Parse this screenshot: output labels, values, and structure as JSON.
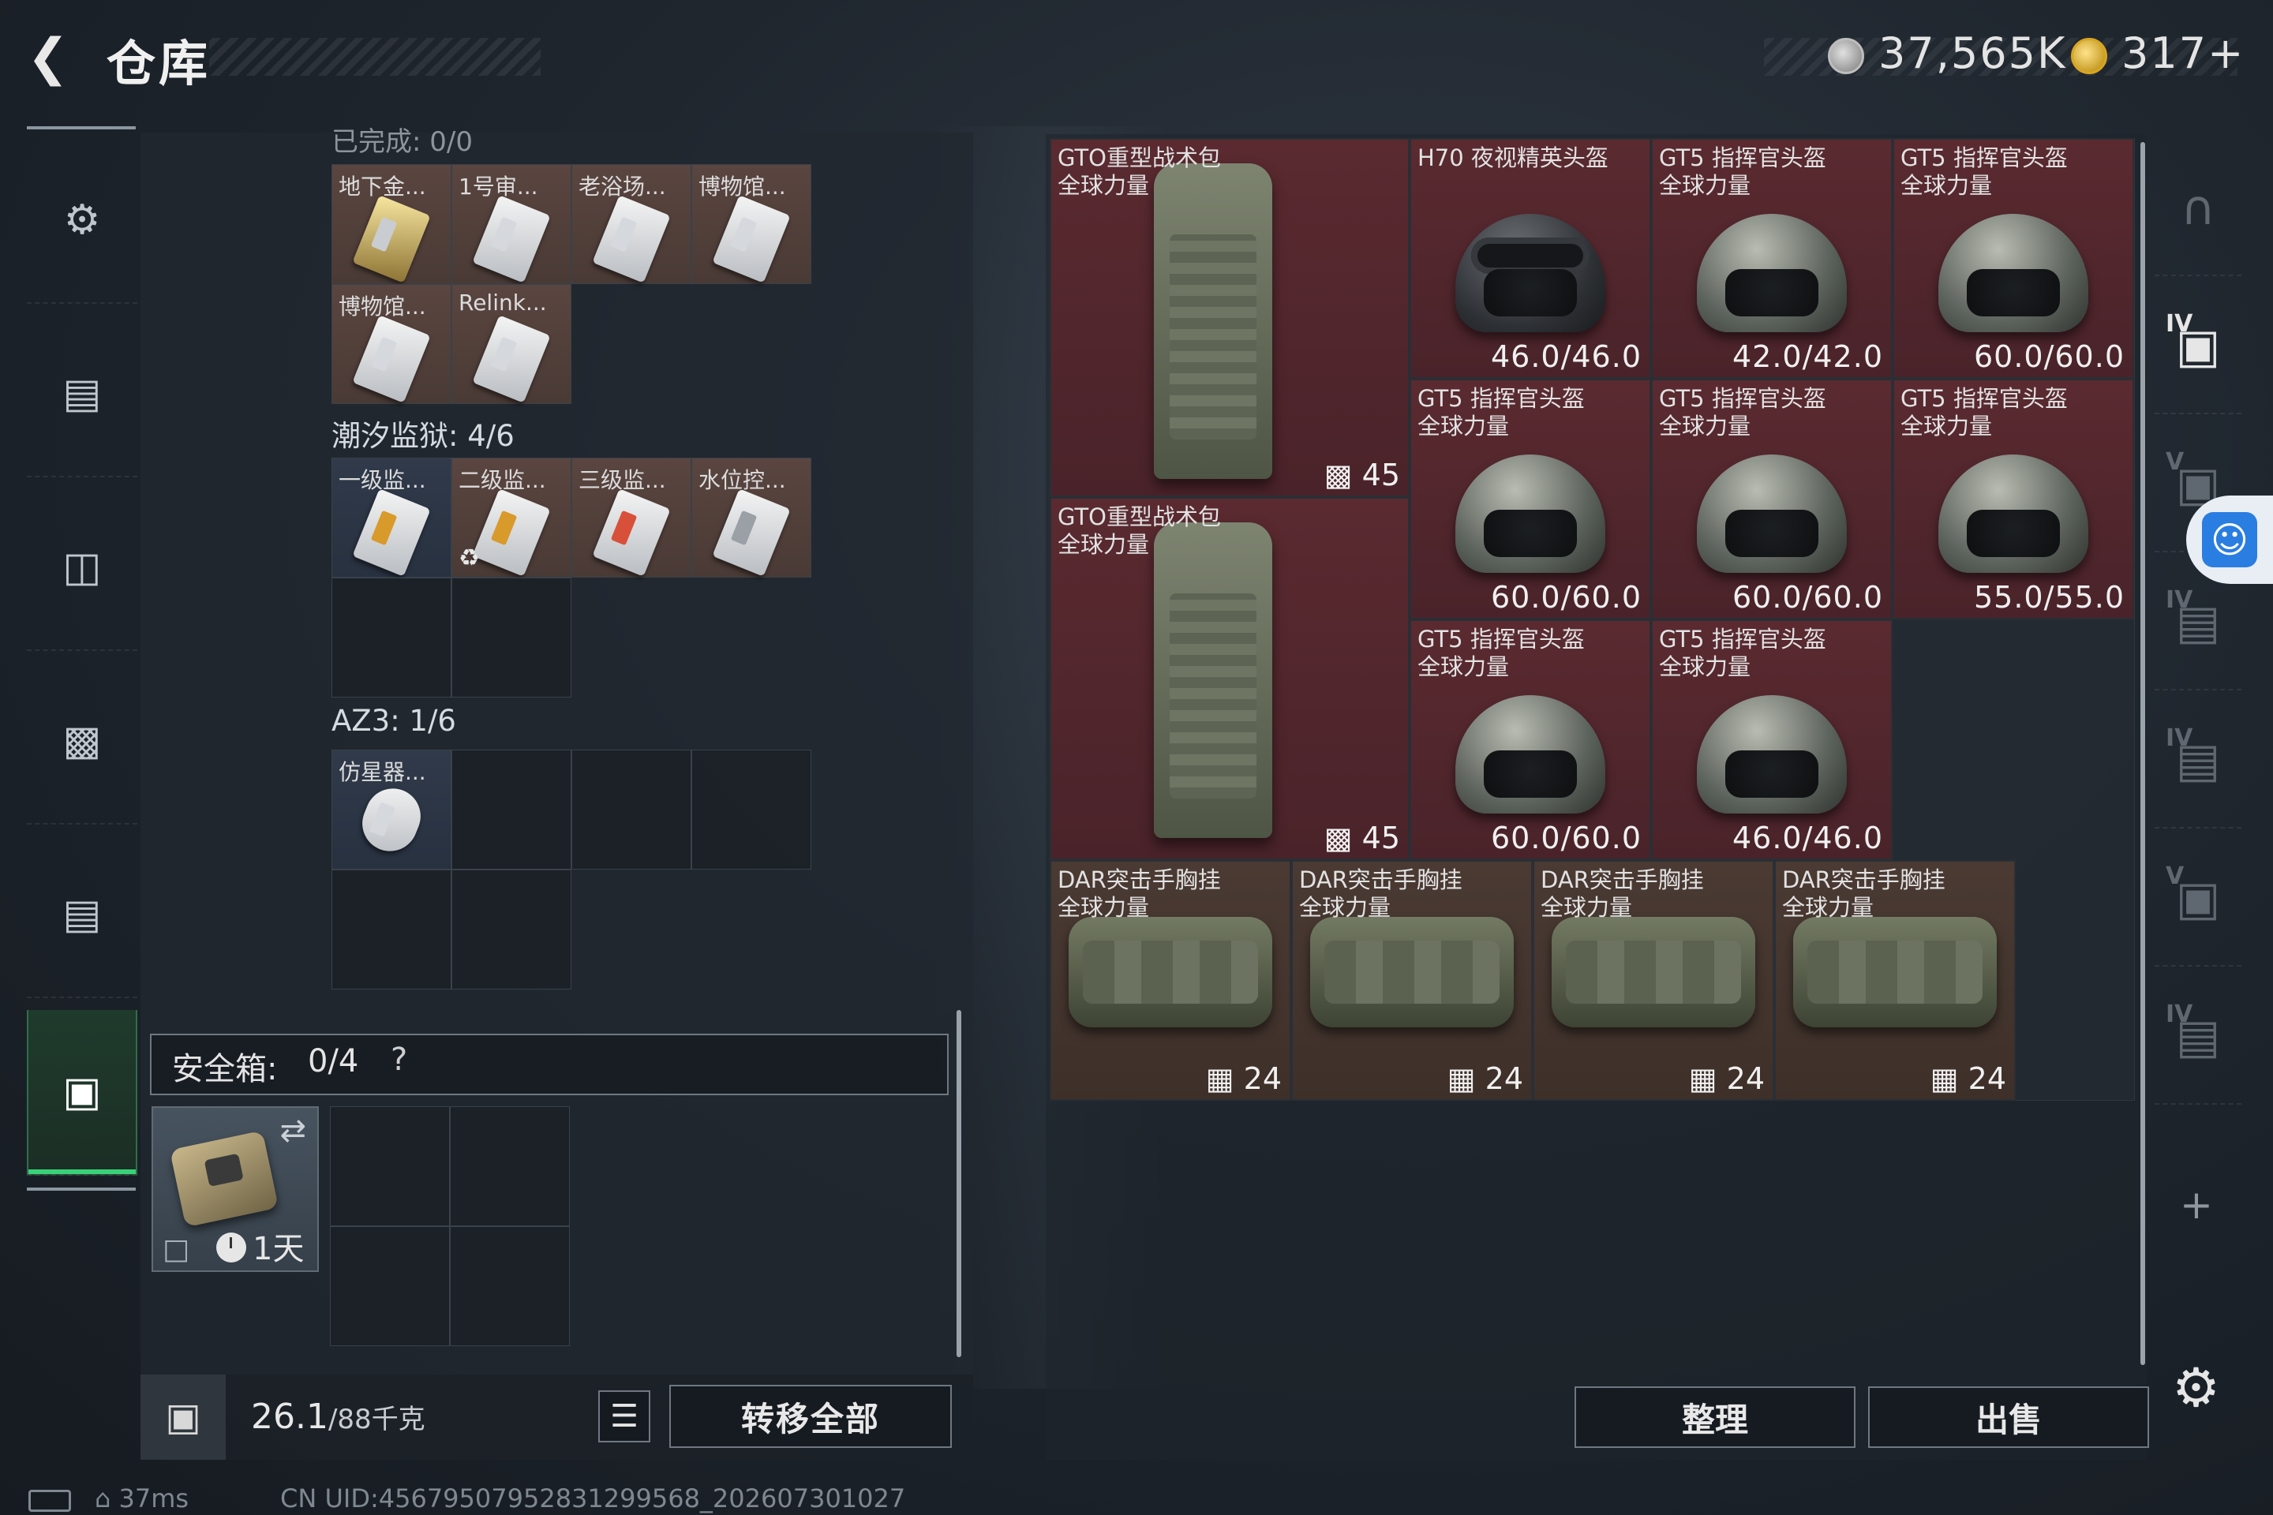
{
  "header": {
    "back_icon": "back-arrow-icon",
    "title": "仓库"
  },
  "currency": {
    "silver": "37,565K",
    "gold": "317+"
  },
  "left_rail": {
    "items": [
      {
        "icon": "rifle-icon"
      },
      {
        "icon": "vest-icon"
      },
      {
        "icon": "backpack-icon"
      },
      {
        "icon": "chest-rig-icon"
      },
      {
        "icon": "container-icon"
      },
      {
        "icon": "toolbox-icon",
        "active": true
      }
    ]
  },
  "key_sections": [
    {
      "label": "已完成: 0/0",
      "keys": [
        "地下金...",
        "1号审...",
        "老浴场...",
        "博物馆...",
        "博物馆...",
        "Relink..."
      ]
    },
    {
      "label": "潮汐监狱: 4/6",
      "keys": [
        "一级监...",
        "二级监...",
        "三级监...",
        "水位控..."
      ]
    },
    {
      "label": "AZ3: 1/6",
      "keys": [
        "仿星器..."
      ]
    }
  ],
  "safe_box": {
    "label": "安全箱:",
    "value": "0/4",
    "help": "?",
    "duration": "1天"
  },
  "footer": {
    "weight_value": "26.1",
    "weight_total": "/88千克",
    "list_icon": "list-icon",
    "transfer_all": "转移全部"
  },
  "stash": {
    "items": [
      {
        "name": "GTO重型战术包\n全球力量",
        "capacity": "45"
      },
      {
        "name": "H70 夜视精英头盔",
        "durability": "46.0/46.0"
      },
      {
        "name": "GT5 指挥官头盔\n全球力量",
        "durability": "42.0/42.0"
      },
      {
        "name": "GT5 指挥官头盔\n全球力量",
        "durability": "60.0/60.0"
      },
      {
        "name": "GT5 指挥官头盔\n全球力量",
        "durability": "60.0/60.0"
      },
      {
        "name": "GT5 指挥官头盔\n全球力量",
        "durability": "60.0/60.0"
      },
      {
        "name": "GT5 指挥官头盔\n全球力量",
        "durability": "55.0/55.0"
      },
      {
        "name": "GTO重型战术包\n全球力量",
        "capacity": "45"
      },
      {
        "name": "GT5 指挥官头盔\n全球力量",
        "durability": "60.0/60.0"
      },
      {
        "name": "GT5 指挥官头盔\n全球力量",
        "durability": "46.0/46.0"
      },
      {
        "name": "DAR突击手胸挂\n全球力量",
        "capacity": "24"
      },
      {
        "name": "DAR突击手胸挂\n全球力量",
        "capacity": "24"
      },
      {
        "name": "DAR突击手胸挂\n全球力量",
        "capacity": "24"
      },
      {
        "name": "DAR突击手胸挂\n全球力量",
        "capacity": "24"
      }
    ],
    "sort": "整理",
    "sell": "出售"
  },
  "right_rail": {
    "tiers": [
      "IV",
      "V",
      "IV",
      "IV",
      "V",
      "IV"
    ],
    "add": "+"
  },
  "status_bar": {
    "ping": "37ms",
    "uid": "CN UID:456795079528312995​68_202607301027"
  }
}
